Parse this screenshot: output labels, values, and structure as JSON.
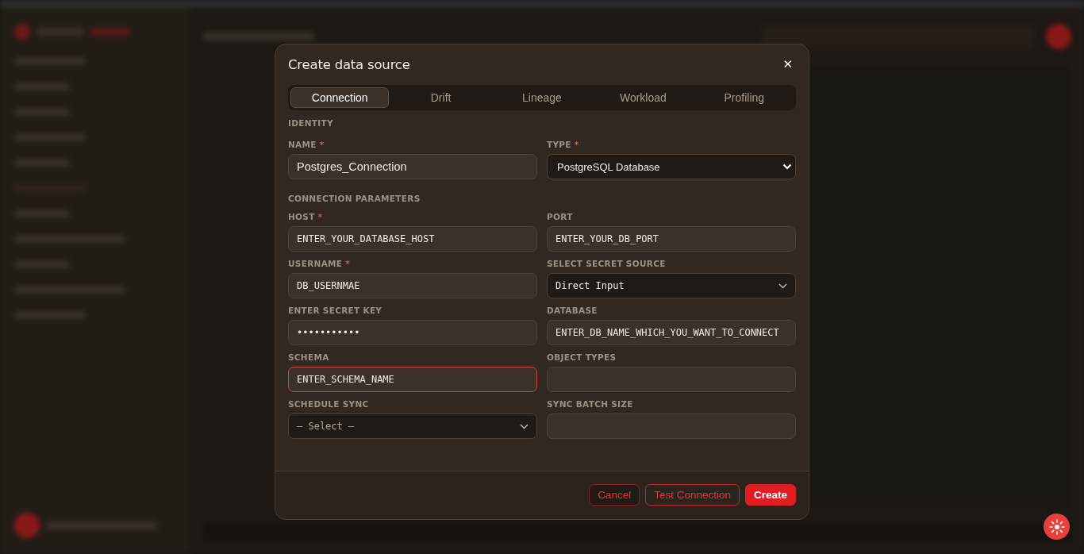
{
  "dialog": {
    "title": "Create data source",
    "close_glyph": "✕"
  },
  "tabs": [
    {
      "label": "Connection",
      "selected": true
    },
    {
      "label": "Drift",
      "selected": false
    },
    {
      "label": "Lineage",
      "selected": false
    },
    {
      "label": "Workload",
      "selected": false
    },
    {
      "label": "Profiling",
      "selected": false
    }
  ],
  "sections": [
    {
      "heading": "IDENTITY",
      "fields": [
        {
          "kind": "text",
          "label": "NAME",
          "required": true,
          "value": "Postgres_Connection",
          "mono": false
        },
        {
          "kind": "native-select",
          "label": "TYPE",
          "required": true,
          "value": "PostgreSQL Database"
        }
      ]
    },
    {
      "heading": "CONNECTION PARAMETERS",
      "fields": [
        {
          "kind": "text",
          "label": "HOST",
          "required": true,
          "value": "ENTER_YOUR_DATABASE_HOST",
          "mono": true
        },
        {
          "kind": "text",
          "label": "PORT",
          "required": false,
          "value": "ENTER_YOUR_DB_PORT",
          "mono": true
        },
        {
          "kind": "text",
          "label": "USERNAME",
          "required": true,
          "value": "DB_USERNMAE",
          "mono": true
        },
        {
          "kind": "select",
          "label": "SELECT SECRET SOURCE",
          "required": false,
          "value": "Direct Input"
        },
        {
          "kind": "password",
          "label": "ENTER SECRET KEY",
          "required": false,
          "value": "•••••••••••"
        },
        {
          "kind": "text",
          "label": "DATABASE",
          "required": false,
          "value": "ENTER_DB_NAME_WHICH_YOU_WANT_TO_CONNECT",
          "mono": true
        },
        {
          "kind": "text",
          "label": "SCHEMA",
          "required": false,
          "value": "ENTER_SCHEMA_NAME",
          "mono": true,
          "focused": true
        },
        {
          "kind": "text",
          "label": "OBJECT TYPES",
          "required": false
        },
        {
          "kind": "select",
          "label": "SCHEDULE SYNC",
          "required": false,
          "placeholder": "— Select —"
        },
        {
          "kind": "text",
          "label": "SYNC BATCH SIZE",
          "required": false
        }
      ]
    }
  ],
  "buttons": [
    {
      "label": "Cancel",
      "kind": "outline-dark"
    },
    {
      "label": "Test Connection",
      "kind": "outline"
    },
    {
      "label": "Create",
      "kind": "primary"
    }
  ],
  "required_mark": "*"
}
